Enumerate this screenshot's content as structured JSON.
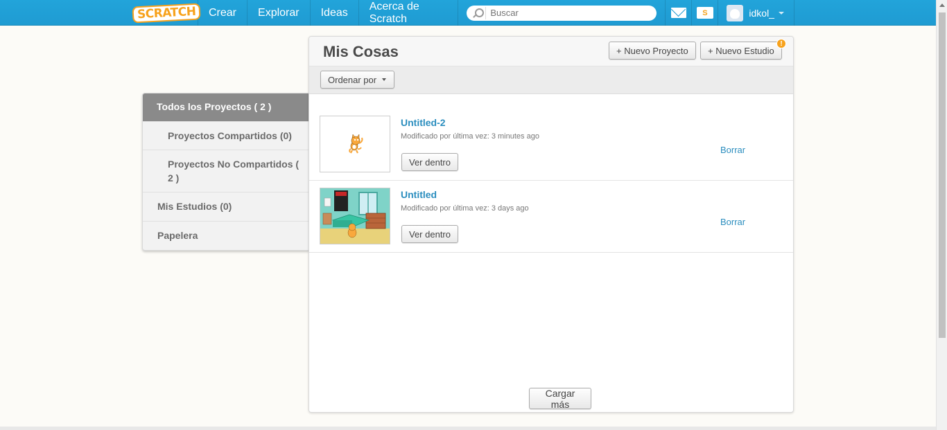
{
  "nav": {
    "logo": "SCRATCH",
    "items": [
      "Crear",
      "Explorar",
      "Ideas",
      "Acerca de Scratch"
    ],
    "search_placeholder": "Buscar",
    "username": "idkol_"
  },
  "header": {
    "title": "Mis Cosas",
    "new_project": "+ Nuevo Proyecto",
    "new_studio": "+ Nuevo Estudio",
    "badge": "!"
  },
  "toolbar": {
    "sort_label": "Ordenar por"
  },
  "sidebar": {
    "items": [
      {
        "label": "Todos los Proyectos ( 2 )"
      },
      {
        "label": "Proyectos Compartidos (0)"
      },
      {
        "label": "Proyectos No Compartidos ( 2 )"
      },
      {
        "label": "Mis Estudios (0)"
      },
      {
        "label": "Papelera"
      }
    ]
  },
  "projects": [
    {
      "title": "Untitled-2",
      "modified": "Modificado por última vez: 3 minutes ago",
      "view": "Ver dentro",
      "delete": "Borrar"
    },
    {
      "title": "Untitled",
      "modified": "Modificado por última vez: 3 days ago",
      "view": "Ver dentro",
      "delete": "Borrar"
    }
  ],
  "load_more": "Cargar más",
  "colors": {
    "nav_bg": "#1f9bd2",
    "link": "#2a8dbe",
    "accent": "#f7a21c"
  }
}
